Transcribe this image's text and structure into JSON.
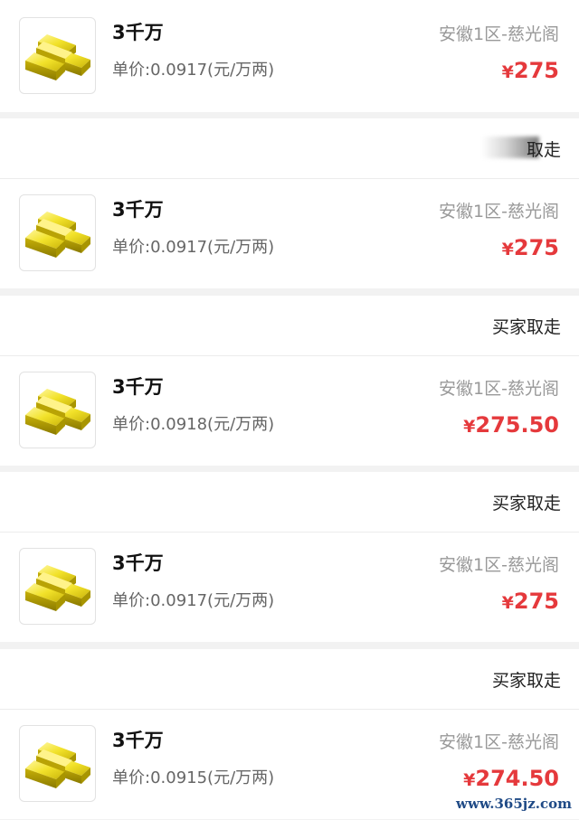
{
  "orders": [
    {
      "status": "",
      "item": {
        "name": "3千万",
        "unit_price": "单价:0.0917(元/万两)",
        "server": "安徽1区-慈光阁",
        "currency": "¥",
        "price": "275"
      }
    },
    {
      "status": "取走",
      "item": {
        "name": "3千万",
        "unit_price": "单价:0.0917(元/万两)",
        "server": "安徽1区-慈光阁",
        "currency": "¥",
        "price": "275"
      }
    },
    {
      "status": "买家取走",
      "item": {
        "name": "3千万",
        "unit_price": "单价:0.0918(元/万两)",
        "server": "安徽1区-慈光阁",
        "currency": "¥",
        "price": "275.50"
      }
    },
    {
      "status": "买家取走",
      "item": {
        "name": "3千万",
        "unit_price": "单价:0.0917(元/万两)",
        "server": "安徽1区-慈光阁",
        "currency": "¥",
        "price": "275"
      }
    },
    {
      "status": "买家取走",
      "item": {
        "name": "3千万",
        "unit_price": "单价:0.0915(元/万两)",
        "server": "安徽1区-慈光阁",
        "currency": "¥",
        "price": "274.50"
      }
    }
  ],
  "watermark": "www.365jz.com",
  "colors": {
    "price": "#e5393c",
    "server": "#999999",
    "gold": "#e8d21a"
  },
  "icons": {
    "item": "gold-bars-icon"
  }
}
